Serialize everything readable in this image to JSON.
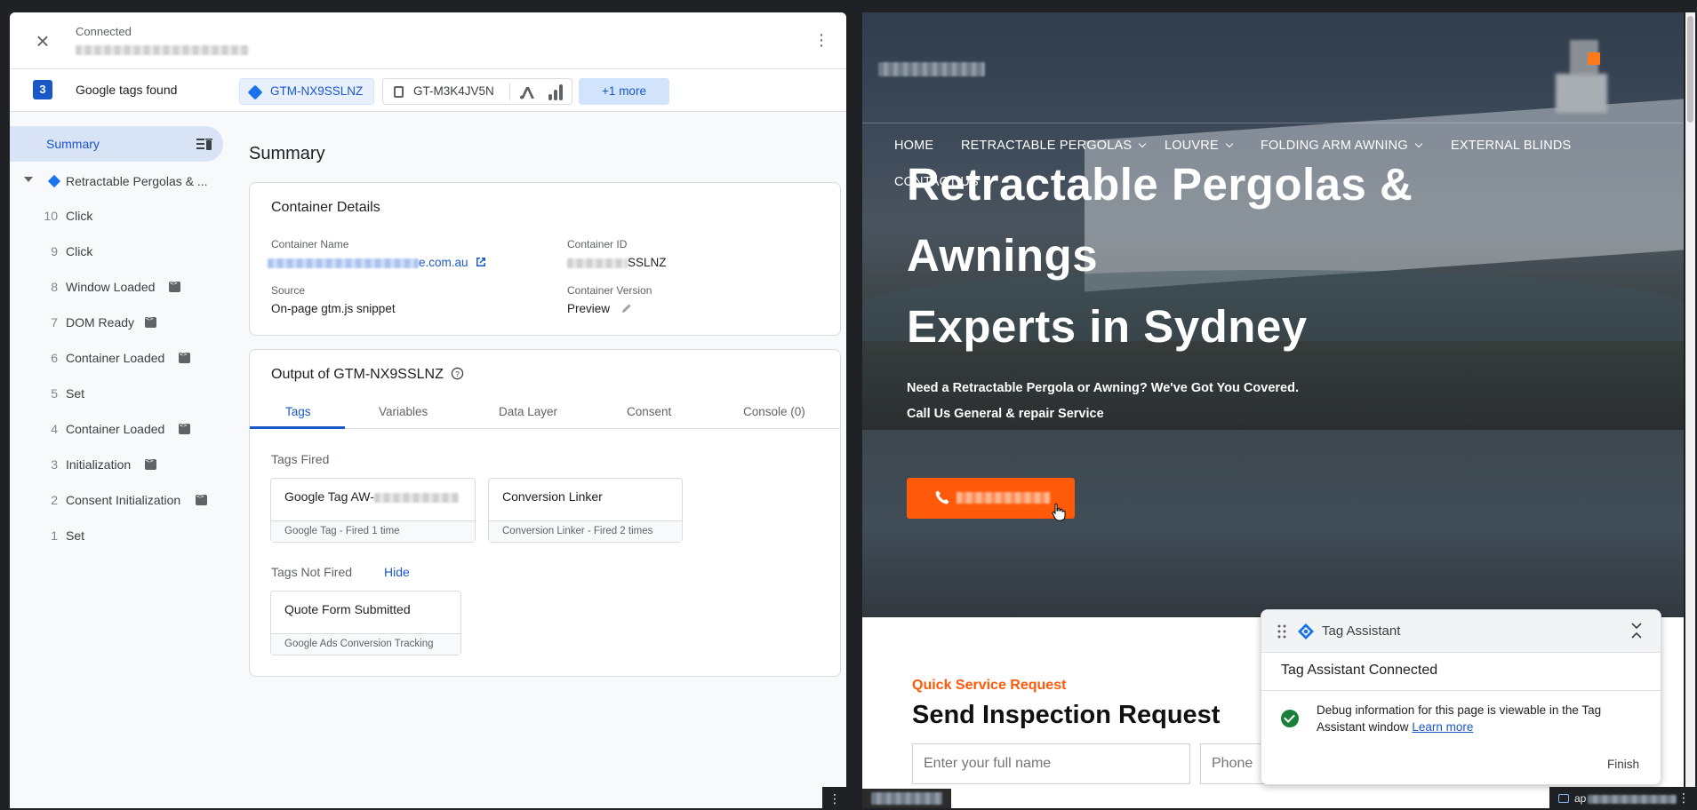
{
  "left_panel": {
    "status": "Connected",
    "tags_found_count": "3",
    "tags_found_label": "Google tags found",
    "chips": {
      "gtm": "GTM-NX9SSLNZ",
      "gt": "GT-M3K4JV5N",
      "more": "+1 more"
    },
    "sidebar": {
      "summary": "Summary",
      "page": "Retractable Pergolas & ...",
      "events": [
        {
          "num": "10",
          "name": "Click",
          "icon": false
        },
        {
          "num": "9",
          "name": "Click",
          "icon": false
        },
        {
          "num": "8",
          "name": "Window Loaded",
          "icon": true
        },
        {
          "num": "7",
          "name": "DOM Ready",
          "icon": true
        },
        {
          "num": "6",
          "name": "Container Loaded",
          "icon": true
        },
        {
          "num": "5",
          "name": "Set",
          "icon": false
        },
        {
          "num": "4",
          "name": "Container Loaded",
          "icon": true
        },
        {
          "num": "3",
          "name": "Initialization",
          "icon": true
        },
        {
          "num": "2",
          "name": "Consent Initialization",
          "icon": true
        },
        {
          "num": "1",
          "name": "Set",
          "icon": false
        }
      ]
    },
    "summary_title": "Summary",
    "container_details": {
      "title": "Container Details",
      "name_label": "Container Name",
      "name_value": "e.com.au",
      "id_label": "Container ID",
      "id_value": "SSLNZ",
      "source_label": "Source",
      "source_value": "On-page gtm.js snippet",
      "version_label": "Container Version",
      "version_value": "Preview"
    },
    "output": {
      "title": "Output of GTM-NX9SSLNZ",
      "tabs": [
        "Tags",
        "Variables",
        "Data Layer",
        "Consent",
        "Console (0)"
      ],
      "tags_fired_label": "Tags Fired",
      "fired": [
        {
          "title": "Google Tag AW-",
          "sub": "Google Tag - Fired 1 time"
        },
        {
          "title": "Conversion Linker",
          "sub": "Conversion Linker - Fired 2 times"
        }
      ],
      "not_fired_label": "Tags Not Fired",
      "hide_label": "Hide",
      "not_fired": [
        {
          "title": "Quote Form Submitted",
          "sub": "Google Ads Conversion Tracking"
        }
      ]
    }
  },
  "website": {
    "nav": {
      "home": "HOME",
      "pergolas": "RETRACTABLE PERGOLAS",
      "louvre": "LOUVRE",
      "folding": "FOLDING ARM AWNING",
      "blinds": "EXTERNAL BLINDS",
      "contact": "CONTACT US"
    },
    "hero": {
      "line1": "Retractable Pergolas &",
      "line2": "Awnings",
      "line3": "Experts in Sydney",
      "lead1": "Need a Retractable Pergola or Awning? We've Got You Covered.",
      "lead2": "Call Us General & repair Service"
    },
    "form": {
      "kicker": "Quick Service Request",
      "title": "Send Inspection Request",
      "name_placeholder": "Enter your full name",
      "phone_placeholder": "Phone"
    },
    "accent_color": "#ff5a0a"
  },
  "tag_assistant": {
    "title": "Tag Assistant",
    "connected": "Tag Assistant Connected",
    "message": "Debug information for this page is viewable in the Tag Assistant window",
    "learn_more": "Learn more",
    "finish": "Finish"
  },
  "url_pill": {
    "text": "ap"
  }
}
